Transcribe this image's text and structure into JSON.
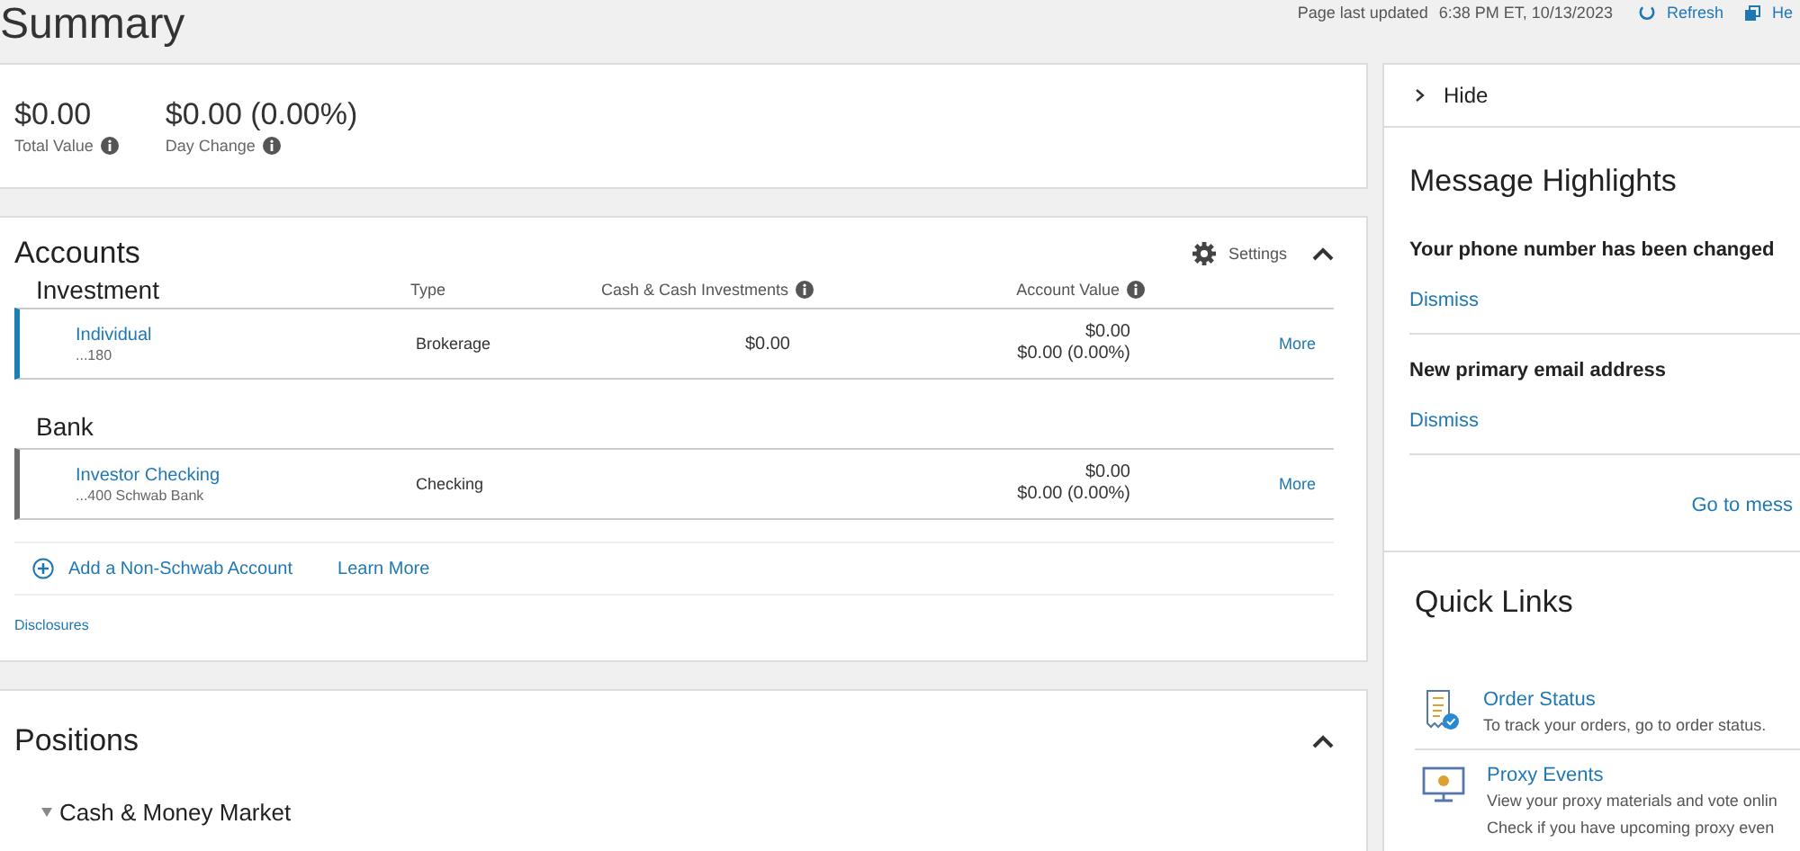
{
  "page": {
    "title": "Summary",
    "last_updated_label": "Page last updated",
    "last_updated": "6:38 PM ET, 10/13/2023",
    "refresh": "Refresh",
    "help": "He"
  },
  "summary": {
    "total_value": "$0.00",
    "total_value_label": "Total Value",
    "day_change": "$0.00 (0.00%)",
    "day_change_label": "Day Change"
  },
  "accounts": {
    "title": "Accounts",
    "settings": "Settings",
    "expanded": true,
    "columns": [
      "Type",
      "Cash & Cash Investments",
      "Account Value"
    ],
    "groups": [
      {
        "name": "Investment",
        "rows": [
          {
            "name": "Individual",
            "number": "...180",
            "type": "Brokerage",
            "cash": "$0.00",
            "value": "$0.00",
            "change": "$0.00 (0.00%)",
            "more": "More",
            "color": "#1a7fb5"
          }
        ]
      },
      {
        "name": "Bank",
        "rows": [
          {
            "name": "Investor Checking",
            "number": "...400 Schwab Bank",
            "type": "Checking",
            "value": "$0.00",
            "change": "$0.00 (0.00%)",
            "more": "More",
            "color": "#6b6b6b"
          }
        ]
      }
    ],
    "add_account": "Add a Non-Schwab Account",
    "learn_more": "Learn More",
    "disclosures": "Disclosures"
  },
  "positions": {
    "title": "Positions",
    "expanded": true,
    "groups": [
      {
        "name": "Cash & Money Market",
        "expanded": true
      }
    ]
  },
  "sidebar": {
    "hide": "Hide",
    "messages": {
      "title": "Message Highlights",
      "items": [
        {
          "title": "Your phone number has been changed",
          "action": "Dismiss"
        },
        {
          "title": "New primary email address",
          "action": "Dismiss"
        }
      ],
      "link": "Go to mess"
    },
    "quick_links": {
      "title": "Quick Links",
      "items": [
        {
          "kind": "receipt",
          "title": "Order Status",
          "lines": [
            "To track your orders, go to order status."
          ]
        },
        {
          "kind": "monitor",
          "title": "Proxy Events",
          "lines": [
            "View your proxy materials and vote onlin",
            "Check if you have upcoming proxy even"
          ]
        }
      ]
    }
  }
}
